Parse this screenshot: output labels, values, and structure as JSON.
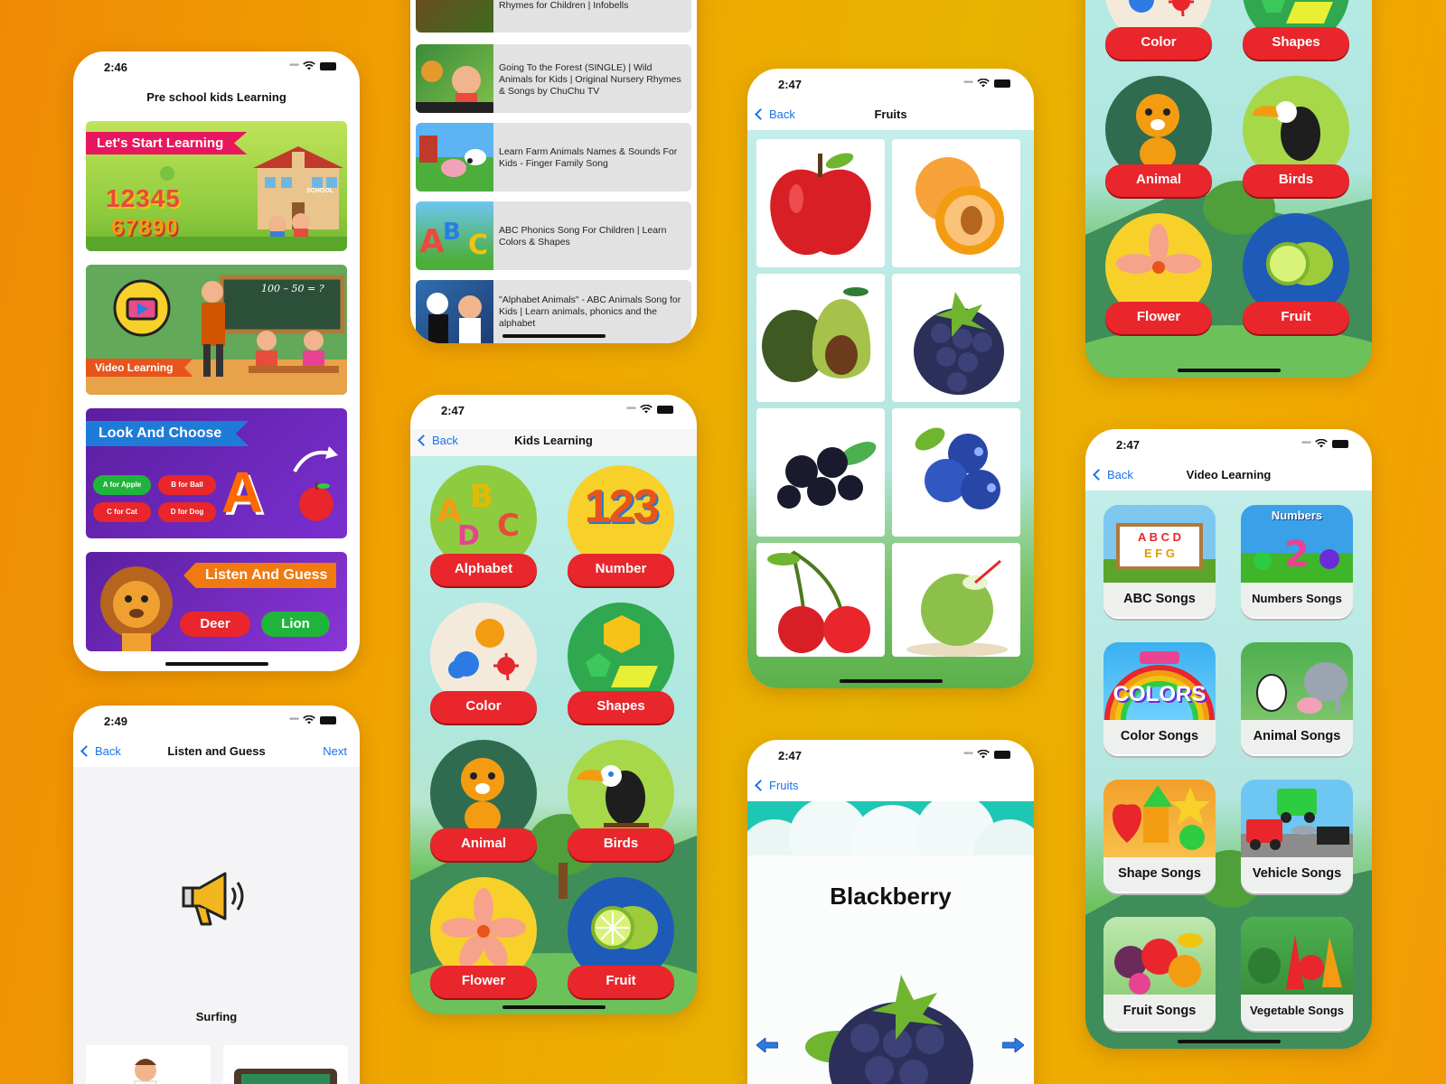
{
  "phone_home": {
    "time": "2:46",
    "title": "Pre school kids Learning",
    "cards": [
      {
        "label": "Let's Start Learning",
        "digits": "12345",
        "digits2": "67890",
        "sign": "SCHOOL"
      },
      {
        "label": "Video Learning",
        "board": "100 – 50 = ?"
      },
      {
        "label": "Look And Choose",
        "pills": [
          "A for Apple",
          "B for Ball",
          "C for Cat",
          "D for Dog"
        ],
        "letter": "A"
      },
      {
        "label": "Listen And Guess",
        "pills": [
          "Deer",
          "Lion"
        ]
      }
    ]
  },
  "phone_playlist": {
    "items": [
      "Rhymes for Children | Infobells",
      "Going To the Forest (SINGLE) | Wild Animals for Kids | Original Nursery Rhymes & Songs by ChuChu TV",
      "Learn Farm Animals Names & Sounds For Kids - Finger Family Song",
      "ABC Phonics Song For Children | Learn Colors & Shapes",
      "\"Alphabet Animals\" - ABC Animals Song for Kids | Learn animals, phonics and the alphabet"
    ]
  },
  "phone_kids": {
    "time": "2:47",
    "back": "Back",
    "title": "Kids Learning",
    "categories": [
      "Alphabet",
      "Number",
      "Color",
      "Shapes",
      "Animal",
      "Birds",
      "Flower",
      "Fruit"
    ],
    "number_art": "123"
  },
  "phone_fruits": {
    "time": "2:47",
    "back": "Back",
    "title": "Fruits"
  },
  "phone_topright": {
    "categories": [
      "Color",
      "Shapes",
      "Animal",
      "Birds",
      "Flower",
      "Fruit"
    ]
  },
  "phone_listen": {
    "time": "2:49",
    "back": "Back",
    "title": "Listen and Guess",
    "next": "Next",
    "word": "Surfing"
  },
  "phone_blackberry": {
    "time": "2:47",
    "back": "Fruits",
    "fruit_name": "Blackberry"
  },
  "phone_video": {
    "time": "2:47",
    "back": "Back",
    "title": "Video Learning",
    "tiles": [
      "ABC Songs",
      "Numbers Songs",
      "Color Songs",
      "Animal Songs",
      "Shape Songs",
      "Vehicle Songs",
      "Fruit Songs",
      "Vegetable Songs"
    ],
    "thumb_texts": {
      "abc": "A B C D",
      "efg": "E F G",
      "numbers": "Numbers",
      "colors": "COLORS"
    }
  },
  "colors": {
    "accent_red": "#e8262b",
    "link_blue": "#1a73e8",
    "background_orange": "#f0a300"
  }
}
